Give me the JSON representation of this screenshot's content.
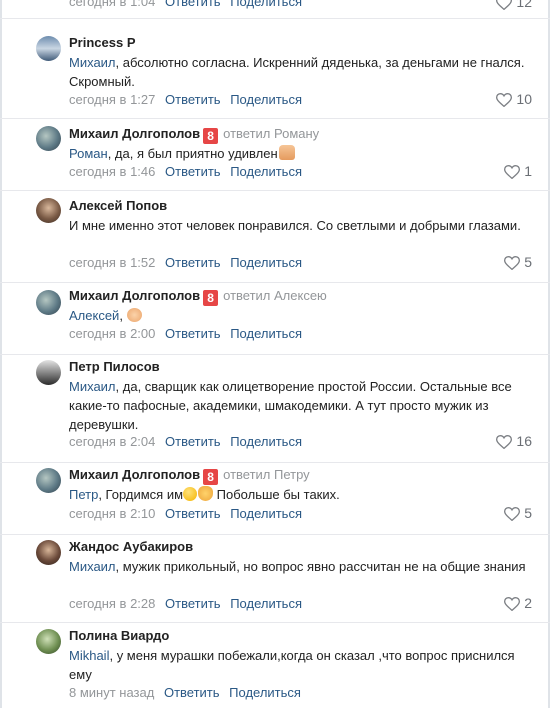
{
  "top_partial": {
    "time": "сегодня в 1:04",
    "reply": "Ответить",
    "share": "Поделиться",
    "likes": "12"
  },
  "comments": [
    {
      "author": "Princess P",
      "mention": "Михаил",
      "text": ", абсолютно согласна. Искренний дяденька, за деньгами не гнался. Скромный.",
      "time": "сегодня в 1:27",
      "reply": "Ответить",
      "share": "Поделиться",
      "likes": "10"
    },
    {
      "author": "Михаил Долгополов",
      "badge": "8",
      "reply_to": "ответил Роману",
      "mention": "Роман",
      "text": ", да, я был приятно удивлен",
      "time": "сегодня в 1:46",
      "reply": "Ответить",
      "share": "Поделиться",
      "likes": "1"
    },
    {
      "author": "Алексей Попов",
      "text": "И мне именно этот человек понравился. Со светлыми и добрыми глазами.",
      "time": "сегодня в 1:52",
      "reply": "Ответить",
      "share": "Поделиться",
      "likes": "5"
    },
    {
      "author": "Михаил Долгополов",
      "badge": "8",
      "reply_to": "ответил Алексею",
      "mention": "Алексей",
      "text": ", ",
      "time": "сегодня в 2:00",
      "reply": "Ответить",
      "share": "Поделиться"
    },
    {
      "author": "Петр Пилосов",
      "mention": "Михаил",
      "text": ", да, сварщик как олицетворение простой России. Остальные все какие-то пафосные, академики, шмакодемики. А тут просто мужик из деревушки.",
      "time": "сегодня в 2:04",
      "reply": "Ответить",
      "share": "Поделиться",
      "likes": "16"
    },
    {
      "author": "Михаил Долгополов",
      "badge": "8",
      "reply_to": "ответил Петру",
      "mention": "Петр",
      "text_a": ", Гордимся им",
      "text_b": " Побольше бы таких.",
      "time": "сегодня в 2:10",
      "reply": "Ответить",
      "share": "Поделиться",
      "likes": "5"
    },
    {
      "author": "Жандос Аубакиров",
      "mention": "Михаил",
      "text": ", мужик прикольный, но вопрос явно рассчитан не на общие знания",
      "time": "сегодня в 2:28",
      "reply": "Ответить",
      "share": "Поделиться",
      "likes": "2"
    },
    {
      "author": "Полина Виардо",
      "mention": "Mikhail",
      "text": ", у меня мурашки побежали,когда он сказал ,что вопрос приснился ему",
      "time": "8 минут назад",
      "reply": "Ответить",
      "share": "Поделиться"
    }
  ],
  "colors": {
    "link": "#2a5885",
    "muted": "#939699",
    "badge": "#e64646"
  }
}
